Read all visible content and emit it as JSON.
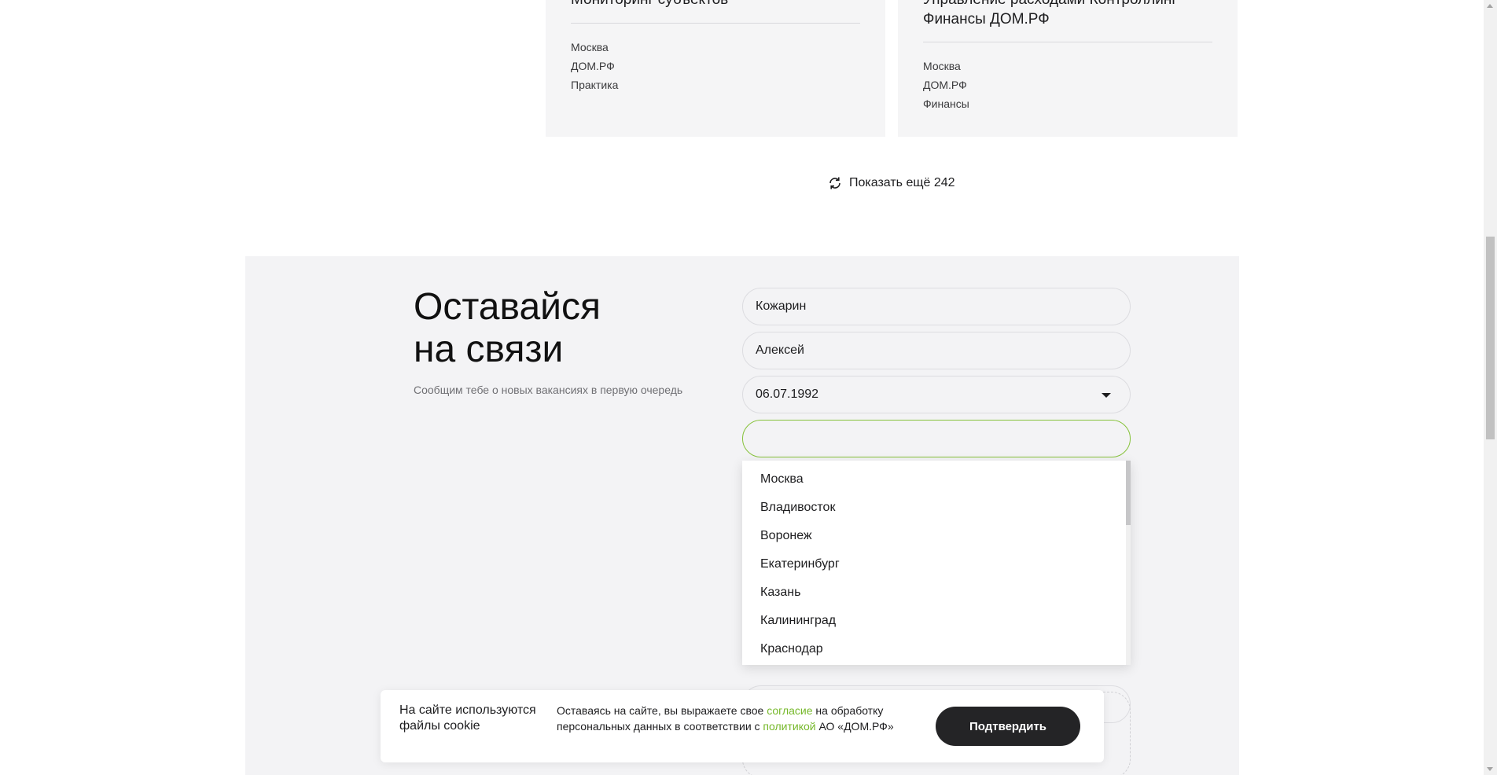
{
  "cards": [
    {
      "title": "Мониторинг субъектов",
      "city": "Москва",
      "company": "ДОМ.РФ",
      "direction": "Практика"
    },
    {
      "title": "Управление расходами Контроллинг Финансы ДОМ.РФ",
      "city": "Москва",
      "company": "ДОМ.РФ",
      "direction": "Финансы"
    }
  ],
  "show_more": {
    "label": "Показать ещё 242",
    "icon": "refresh-icon"
  },
  "subscribe": {
    "title_line1": "Оставайся",
    "title_line2": "на связи",
    "subtitle": "Сообщим тебе о новых вакансиях в первую очередь",
    "last_name": "Кожарин",
    "first_name": "Алексей",
    "birthdate": "06.07.1992",
    "city_value": ""
  },
  "city_dropdown": {
    "options": [
      "Москва",
      "Владивосток",
      "Воронеж",
      "Екатеринбург",
      "Казань",
      "Калининград",
      "Краснодар"
    ]
  },
  "cookie": {
    "title": "На сайте используются файлы cookie",
    "text_before_link1": "Оставаясь на сайте, вы выражаете свое ",
    "link1": "согласие",
    "text_between": " на обработку персональных данных в соответствии с ",
    "link2": "политикой",
    "text_after": " АО «ДОМ.РФ»",
    "button": "Подтвердить"
  },
  "colors": {
    "accent_green": "#76b82a",
    "focus_border": "#86c23a",
    "button_dark": "#242426",
    "section_bg": "#f3f3f5"
  }
}
